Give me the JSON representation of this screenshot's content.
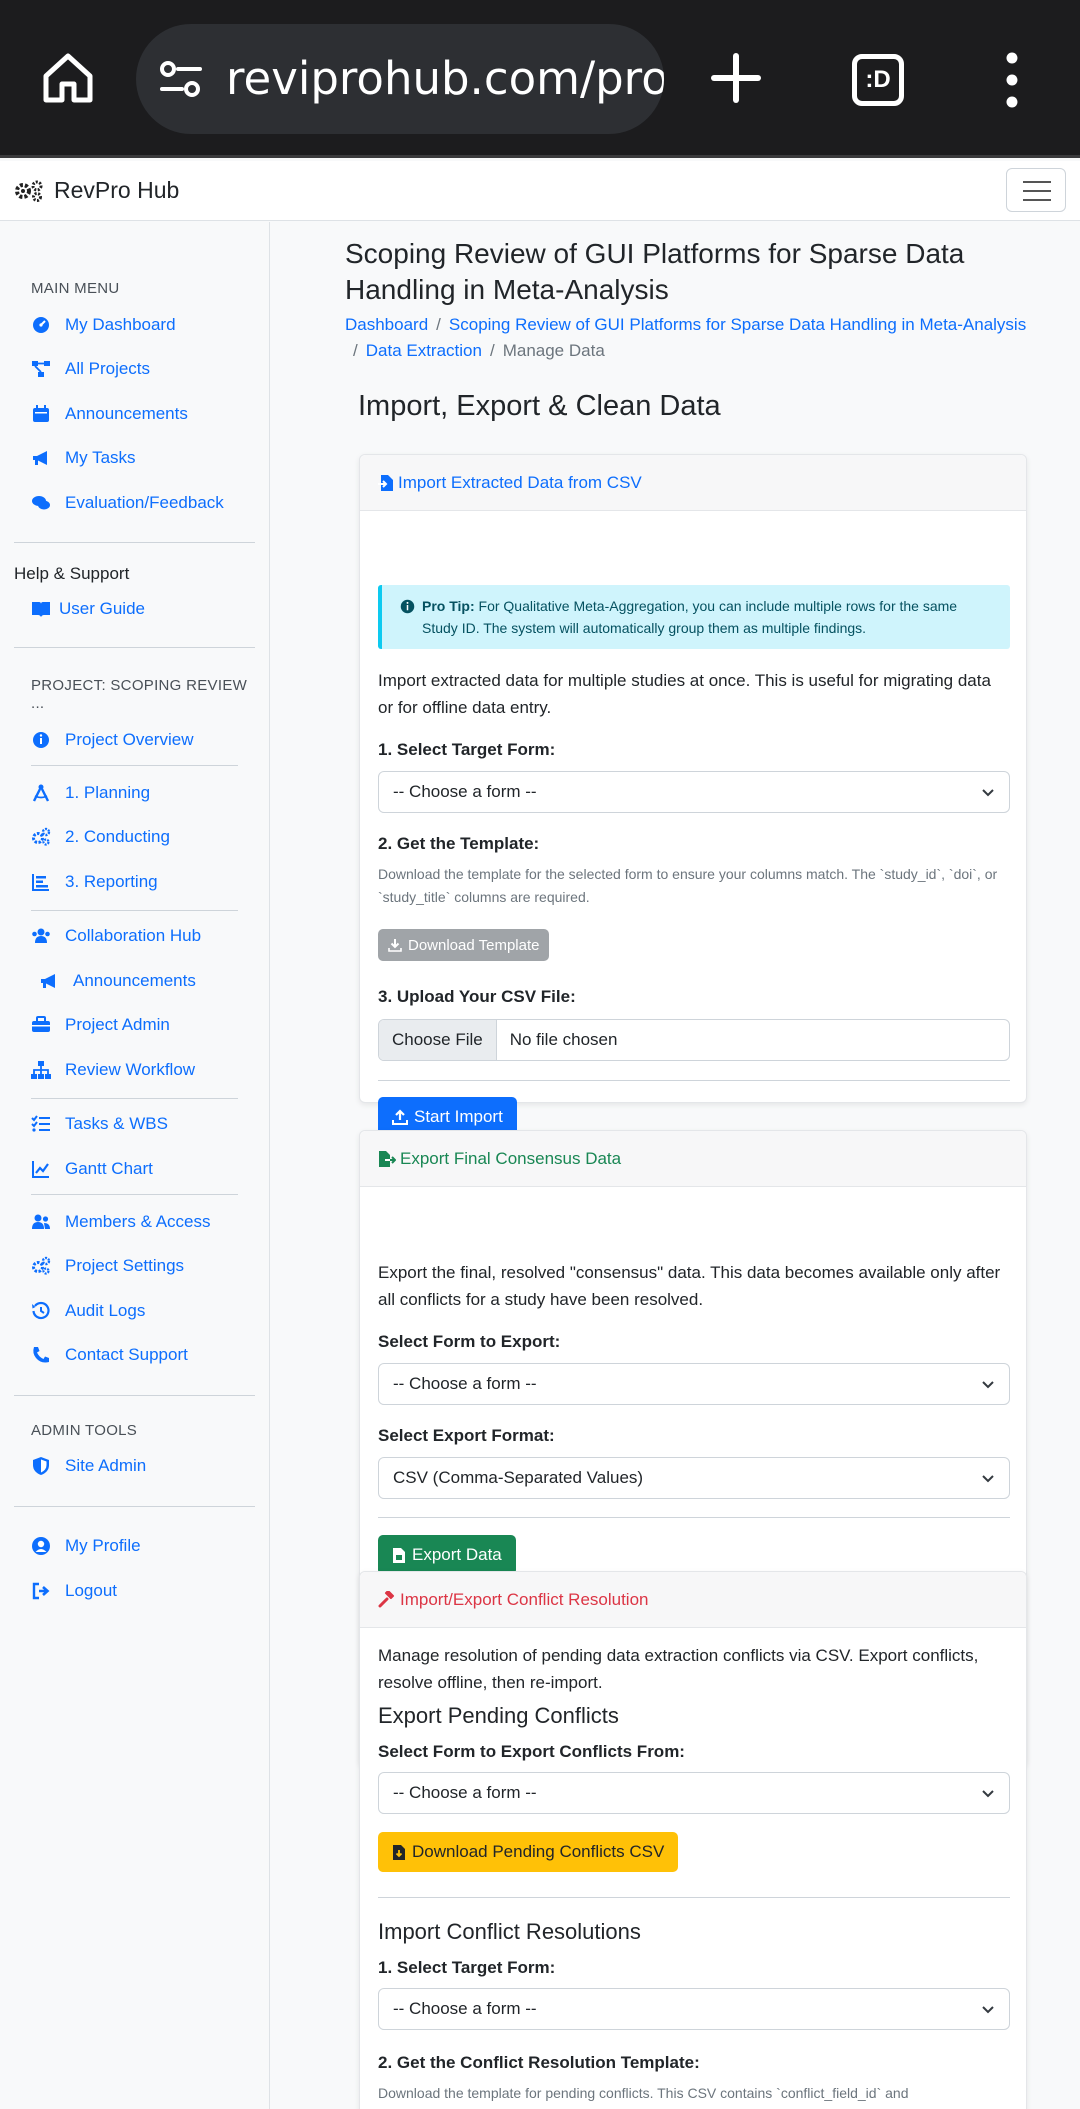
{
  "browser": {
    "url": "reviprohub.com/proje",
    "tabs_label": ":D"
  },
  "navbar": {
    "brand": "RevPro Hub"
  },
  "sidebar": {
    "main_menu_heading": "MAIN MENU",
    "main_menu": [
      {
        "label": "My Dashboard",
        "icon": "gauge-icon"
      },
      {
        "label": "All Projects",
        "icon": "project-diagram-icon"
      },
      {
        "label": "Announcements",
        "icon": "calendar-icon"
      },
      {
        "label": "My Tasks",
        "icon": "bullhorn-icon"
      },
      {
        "label": "Evaluation/Feedback",
        "icon": "comments-icon"
      }
    ],
    "help_heading": "Help & Support",
    "user_guide": "User Guide",
    "project_heading_line1": "PROJECT: SCOPING REVIEW",
    "project_heading_line2": "...",
    "project_items": [
      "Project Overview",
      "1. Planning",
      "2. Conducting",
      "3. Reporting",
      "Collaboration Hub",
      "Announcements",
      "Project Admin",
      "Review Workflow",
      "Tasks & WBS",
      "Gantt Chart",
      "Members & Access",
      "Project Settings",
      "Audit Logs",
      "Contact Support"
    ],
    "admin_heading": "ADMIN TOOLS",
    "site_admin": "Site Admin",
    "my_profile": "My Profile",
    "logout": "Logout"
  },
  "main": {
    "title": "Scoping Review of GUI Platforms for Sparse Data Handling in Meta-Analysis",
    "breadcrumbs": {
      "dashboard": "Dashboard",
      "project": "Scoping Review of GUI Platforms for Sparse Data Handling in Meta-Analysis",
      "extraction": "Data Extraction",
      "current": "Manage Data"
    },
    "section_title": "Import, Export & Clean Data",
    "import_card": {
      "header": "Import Extracted Data from CSV",
      "tip_label": "Pro Tip:",
      "tip_text": "For Qualitative Meta-Aggregation, you can include multiple rows for the same Study ID. The system will automatically group them as multiple findings.",
      "intro": "Import extracted data for multiple studies at once. This is useful for migrating data or for offline data entry.",
      "step1_label": "1. Select Target Form:",
      "step1_value": "-- Choose a form --",
      "step2_label": "2. Get the Template:",
      "step2_help": "Download the template for the selected form to ensure your columns match. The `study_id`, `doi`, or `study_title` columns are required.",
      "download_template": "Download Template",
      "step3_label": "3. Upload Your CSV File:",
      "choose_file": "Choose File",
      "no_file": "No file chosen",
      "start_import": "Start Import"
    },
    "export_card": {
      "header": "Export Final Consensus Data",
      "intro": "Export the final, resolved \"consensus\" data. This data becomes available only after all conflicts for a study have been resolved.",
      "form_label": "Select Form to Export:",
      "form_value": "-- Choose a form --",
      "format_label": "Select Export Format:",
      "format_value": "CSV (Comma-Separated Values)",
      "export_button": "Export Data"
    },
    "conflict_card": {
      "header": "Import/Export Conflict Resolution",
      "intro": "Manage resolution of pending data extraction conflicts via CSV. Export conflicts, resolve offline, then re-import.",
      "export_heading": "Export Pending Conflicts",
      "export_form_label": "Select Form to Export Conflicts From:",
      "export_form_value": "-- Choose a form --",
      "download_conflicts": "Download Pending Conflicts CSV",
      "import_heading": "Import Conflict Resolutions",
      "import_step1_label": "1. Select Target Form:",
      "import_step1_value": "-- Choose a form --",
      "import_step2_label": "2. Get the Conflict Resolution Template:",
      "import_step2_help": "Download the template for pending conflicts. This CSV contains `conflict_field_id` and"
    }
  },
  "colors": {
    "primary": "#0d6efd",
    "success": "#198754",
    "danger": "#dc3545",
    "warning": "#ffc107",
    "info_bg": "#cff4fc"
  }
}
